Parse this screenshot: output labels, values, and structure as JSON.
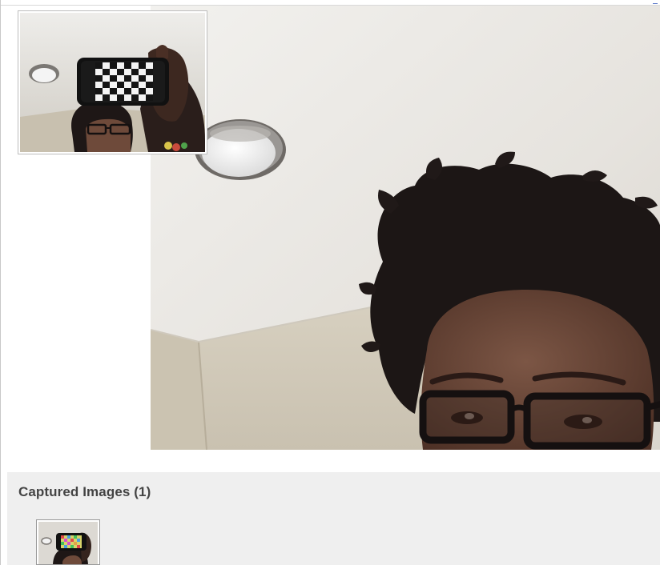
{
  "captured": {
    "title": "Captured Images (1)",
    "count": 1,
    "thumbnails": [
      {
        "name": "captured-image-1"
      }
    ]
  },
  "colors": {
    "panel_background": "#efefef",
    "title_text": "#444444",
    "ceiling": "#e9e6e1",
    "hair": "#1d1716",
    "skin": "#6a4636"
  }
}
